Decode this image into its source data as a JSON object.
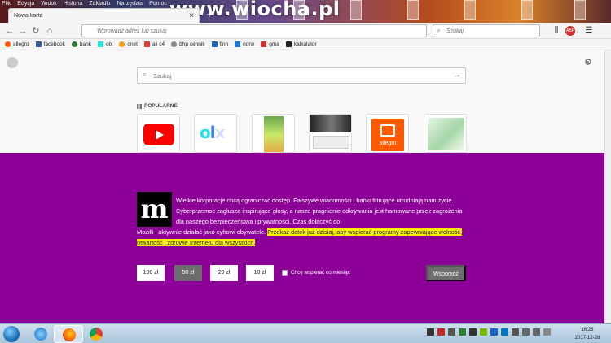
{
  "menubar": [
    "Plik",
    "Edycja",
    "Widok",
    "Historia",
    "Zakładki",
    "Narzędzia",
    "Pomoc"
  ],
  "watermark": "www.wiocha.pl",
  "tab": {
    "title": "Nowa karta",
    "close_glyph": "×",
    "new_tab_glyph": "+"
  },
  "navbar": {
    "url_placeholder": "Wprowadź adres lub szukaj",
    "search_placeholder": "Szukaj",
    "icons": [
      "back-arrow",
      "forward-arrow",
      "reload",
      "home",
      "library",
      "adblock",
      "menu"
    ]
  },
  "bookmarks": [
    {
      "label": "allegro",
      "color": "#ff5a00"
    },
    {
      "label": "facebook",
      "color": "#3b5998"
    },
    {
      "label": "bank",
      "color": "#2e7d32"
    },
    {
      "label": "olx",
      "color": "#23e5db"
    },
    {
      "label": "onet",
      "color": "#f39c12"
    },
    {
      "label": "ali c4",
      "color": "#e53935"
    },
    {
      "label": "bhp cennik",
      "color": "#888888"
    },
    {
      "label": "finn",
      "color": "#1565c0"
    },
    {
      "label": "norw",
      "color": "#1976d2"
    },
    {
      "label": "gma",
      "color": "#d32f2f"
    },
    {
      "label": "kalkulator",
      "color": "#222222"
    }
  ],
  "newtab": {
    "search_placeholder": "Szukaj",
    "popular_label": "POPULARNE",
    "tiles": [
      {
        "name": "youtube"
      },
      {
        "name": "olx"
      },
      {
        "name": "game-site"
      },
      {
        "name": "video-site"
      },
      {
        "name": "allegro",
        "label": "allegro"
      },
      {
        "name": "shop-site"
      }
    ]
  },
  "donation": {
    "logo_letter": "m",
    "text_first": "Wielkie korporacje chcą ograniczać dostęp. Fałszywe wiadomości i bańki filtrujące utrudniają nam życie. Cyberprzemoc zagłusza inspirujące głosy, a nasze pragnienie odkrywania jest hamowane przez zagrożenia dla naszego bezpieczeństwa i prywatności. Czas dołączyć do",
    "text_second": "Mozilli i aktywnie działać jako cyfrowi obywatele.",
    "highlight": "Przekaż datek już dzisiaj, aby wspierać programy zapewniające wolność, otwartość i zdrowie Internetu dla wszystkich.",
    "amounts": [
      "100 zł",
      "50 zł",
      "20 zł",
      "10 zł"
    ],
    "selected_amount_index": 1,
    "monthly_label": "Chcę wspierać co miesiąc",
    "donate_label": "Wspomóż",
    "colors": {
      "background": "#8c0097",
      "highlight": "#fff200",
      "button": "#6d6d6d"
    }
  },
  "taskbar": {
    "apps": [
      "windows-start",
      "ie-explorer",
      "firefox",
      "chrome"
    ],
    "time": "16:28",
    "date": "2017-12-28"
  }
}
